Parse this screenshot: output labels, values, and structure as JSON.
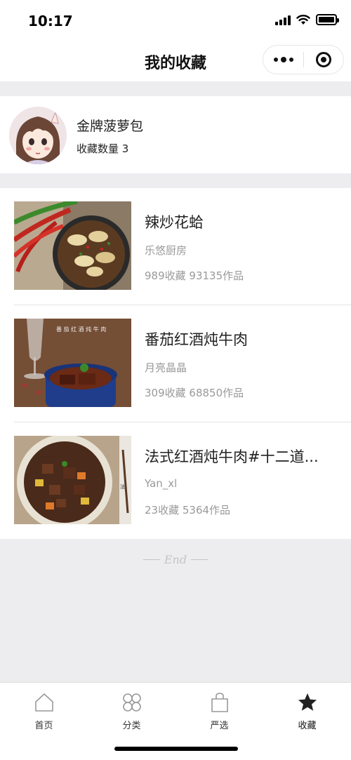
{
  "status_bar": {
    "time": "10:17"
  },
  "nav": {
    "title": "我的收藏"
  },
  "profile": {
    "name": "金牌菠萝包",
    "fav_count": "收藏数量 3"
  },
  "items": [
    {
      "title": "辣炒花蛤",
      "author": "乐悠厨房",
      "stats": "989收藏 93135作品"
    },
    {
      "title": "番茄红酒炖牛肉",
      "author": "月亮晶晶",
      "stats": "309收藏 68850作品"
    },
    {
      "title": "法式红酒炖牛肉#十二道...",
      "author": "Yan_xl",
      "stats": "23收藏 5364作品"
    }
  ],
  "end_text": "End",
  "tabs": [
    {
      "label": "首页",
      "icon": "home-icon"
    },
    {
      "label": "分类",
      "icon": "category-icon"
    },
    {
      "label": "严选",
      "icon": "shopping-bag-icon"
    },
    {
      "label": "收藏",
      "icon": "star-icon"
    }
  ],
  "colors": {
    "background": "#ededf0",
    "text": "#222222",
    "muted": "#999999"
  }
}
